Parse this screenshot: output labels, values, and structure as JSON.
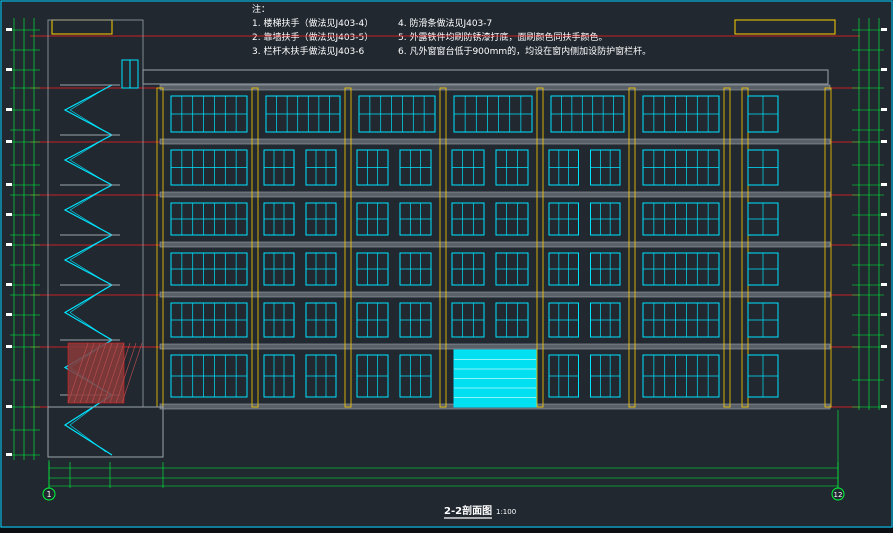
{
  "drawing": {
    "notes_title": "注：",
    "notes": [
      "1. 楼梯扶手（做法见J403-4）",
      "2. 靠墙扶手（做法见J403-5）",
      "3. 栏杆木扶手做法见J403-6",
      "4. 防滑条做法见J403-7",
      "5. 外露铁件均刷防锈漆打底，面刷颜色同扶手颜色。",
      "6. 凡外窗窗台低于900mm的，均设在窗内侧加设防护窗栏杆。"
    ],
    "title": "2-2剖面图",
    "scale": "1:100",
    "grid_axes": [
      "1",
      "12"
    ],
    "colors": {
      "background": "#212830",
      "wall_line": "#ffd000",
      "window": "#00e5ff",
      "floor_line": "#ff2020",
      "dimension": "#00ff3c",
      "text": "#ffffff",
      "structure": "#9aa3ab"
    }
  }
}
